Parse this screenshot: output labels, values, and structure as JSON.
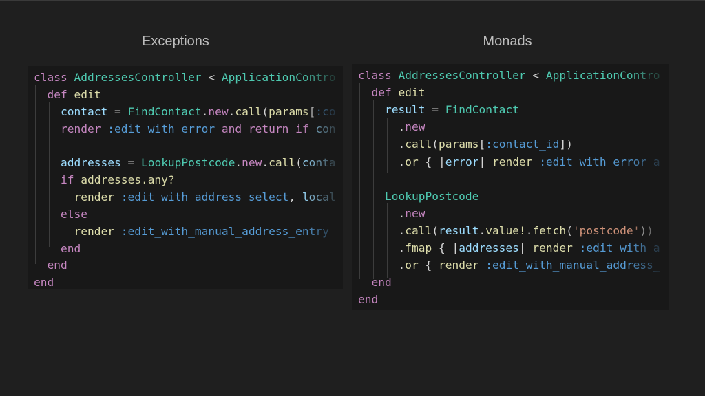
{
  "titles": {
    "left": "Exceptions",
    "right": "Monads"
  },
  "code": {
    "left": [
      [
        [
          "kw",
          "class "
        ],
        [
          "cls",
          "AddressesController"
        ],
        [
          "op",
          " < "
        ],
        [
          "cls",
          "ApplicationContro"
        ]
      ],
      [
        [
          "kw",
          "  def "
        ],
        [
          "fn",
          "edit"
        ]
      ],
      [
        [
          "id",
          "    contact"
        ],
        [
          "op",
          " = "
        ],
        [
          "cls",
          "FindContact"
        ],
        [
          "op",
          "."
        ],
        [
          "kw",
          "new"
        ],
        [
          "op",
          "."
        ],
        [
          "fn",
          "call"
        ],
        [
          "op",
          "("
        ],
        [
          "fn",
          "params"
        ],
        [
          "op",
          "["
        ],
        [
          "sym",
          ":co"
        ]
      ],
      [
        [
          "kw",
          "    render "
        ],
        [
          "sym",
          ":edit_with_error "
        ],
        [
          "kw",
          "and return if "
        ],
        [
          "id",
          "con"
        ]
      ],
      [
        [
          "txt",
          ""
        ]
      ],
      [
        [
          "id",
          "    addresses"
        ],
        [
          "op",
          " = "
        ],
        [
          "cls",
          "LookupPostcode"
        ],
        [
          "op",
          "."
        ],
        [
          "kw",
          "new"
        ],
        [
          "op",
          "."
        ],
        [
          "fn",
          "call"
        ],
        [
          "op",
          "("
        ],
        [
          "id",
          "conta"
        ]
      ],
      [
        [
          "kw",
          "    if "
        ],
        [
          "fn",
          "addresses.any?"
        ]
      ],
      [
        [
          "fn",
          "      render "
        ],
        [
          "sym",
          ":edit_with_address_select"
        ],
        [
          "op",
          ", "
        ],
        [
          "id",
          "local"
        ]
      ],
      [
        [
          "kw",
          "    else"
        ]
      ],
      [
        [
          "fn",
          "      render "
        ],
        [
          "sym",
          ":edit_with_manual_address_entry"
        ]
      ],
      [
        [
          "kw",
          "    end"
        ]
      ],
      [
        [
          "kw",
          "  end"
        ]
      ],
      [
        [
          "kw",
          "end"
        ]
      ]
    ],
    "right": [
      [
        [
          "kw",
          "class "
        ],
        [
          "cls",
          "AddressesController"
        ],
        [
          "op",
          " < "
        ],
        [
          "cls",
          "ApplicationContro"
        ]
      ],
      [
        [
          "kw",
          "  def "
        ],
        [
          "fn",
          "edit"
        ]
      ],
      [
        [
          "id",
          "    result"
        ],
        [
          "op",
          " = "
        ],
        [
          "cls",
          "FindContact"
        ]
      ],
      [
        [
          "op",
          "      ."
        ],
        [
          "kw",
          "new"
        ]
      ],
      [
        [
          "op",
          "      ."
        ],
        [
          "fn",
          "call"
        ],
        [
          "op",
          "("
        ],
        [
          "fn",
          "params"
        ],
        [
          "op",
          "["
        ],
        [
          "sym",
          ":contact_id"
        ],
        [
          "op",
          "])"
        ]
      ],
      [
        [
          "op",
          "      ."
        ],
        [
          "fn",
          "or"
        ],
        [
          "op",
          " { |"
        ],
        [
          "id",
          "error"
        ],
        [
          "op",
          "| "
        ],
        [
          "fn",
          "render "
        ],
        [
          "sym",
          ":edit_with_error a"
        ]
      ],
      [
        [
          "txt",
          ""
        ]
      ],
      [
        [
          "cls",
          "    LookupPostcode"
        ]
      ],
      [
        [
          "op",
          "      ."
        ],
        [
          "kw",
          "new"
        ]
      ],
      [
        [
          "op",
          "      ."
        ],
        [
          "fn",
          "call"
        ],
        [
          "op",
          "("
        ],
        [
          "id",
          "result"
        ],
        [
          "op",
          "."
        ],
        [
          "fn",
          "value!"
        ],
        [
          "op",
          "."
        ],
        [
          "fn",
          "fetch"
        ],
        [
          "op",
          "("
        ],
        [
          "str",
          "'postcode'"
        ],
        [
          "op",
          "))"
        ]
      ],
      [
        [
          "op",
          "      ."
        ],
        [
          "fn",
          "fmap"
        ],
        [
          "op",
          " { |"
        ],
        [
          "id",
          "addresses"
        ],
        [
          "op",
          "| "
        ],
        [
          "fn",
          "render "
        ],
        [
          "sym",
          ":edit_with_a"
        ]
      ],
      [
        [
          "op",
          "      ."
        ],
        [
          "fn",
          "or"
        ],
        [
          "op",
          " { "
        ],
        [
          "fn",
          "render "
        ],
        [
          "sym",
          ":edit_with_manual_address_"
        ]
      ],
      [
        [
          "kw",
          "  end"
        ]
      ],
      [
        [
          "kw",
          "end"
        ]
      ]
    ]
  }
}
